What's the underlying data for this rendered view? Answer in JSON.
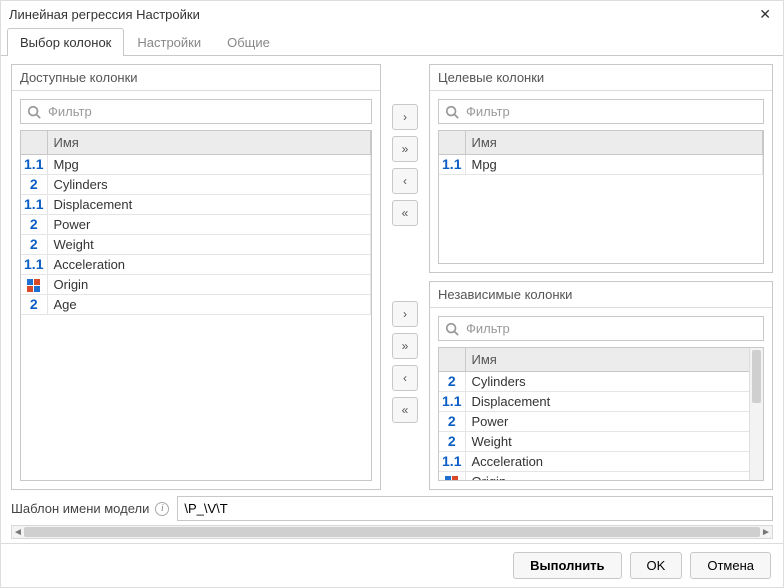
{
  "window": {
    "title": "Линейная регрессия Настройки",
    "close_symbol": "✕"
  },
  "tabs": [
    {
      "label": "Выбор колонок",
      "active": true
    },
    {
      "label": "Настройки",
      "active": false
    },
    {
      "label": "Общие",
      "active": false
    }
  ],
  "filter_placeholder": "Фильтр",
  "name_header": "Имя",
  "panels": {
    "available": {
      "title": "Доступные колонки",
      "rows": [
        {
          "type": "float",
          "name": "Mpg"
        },
        {
          "type": "int",
          "name": "Cylinders"
        },
        {
          "type": "float",
          "name": "Displacement"
        },
        {
          "type": "int",
          "name": "Power"
        },
        {
          "type": "int",
          "name": "Weight"
        },
        {
          "type": "float",
          "name": "Acceleration"
        },
        {
          "type": "cat",
          "name": "Origin"
        },
        {
          "type": "int",
          "name": "Age"
        }
      ]
    },
    "target": {
      "title": "Целевые колонки",
      "rows": [
        {
          "type": "float",
          "name": "Mpg"
        }
      ]
    },
    "independent": {
      "title": "Независимые колонки",
      "rows": [
        {
          "type": "int",
          "name": "Cylinders"
        },
        {
          "type": "float",
          "name": "Displacement"
        },
        {
          "type": "int",
          "name": "Power"
        },
        {
          "type": "int",
          "name": "Weight"
        },
        {
          "type": "float",
          "name": "Acceleration"
        },
        {
          "type": "cat",
          "name": "Origin"
        }
      ]
    }
  },
  "transfer": {
    "move_right": "›",
    "move_all_right": "»",
    "move_left": "‹",
    "move_all_left": "«"
  },
  "model_template": {
    "label": "Шаблон имени модели",
    "value": "\\P_\\V\\T"
  },
  "footer": {
    "run": "Выполнить",
    "ok": "OK",
    "cancel": "Отмена"
  }
}
